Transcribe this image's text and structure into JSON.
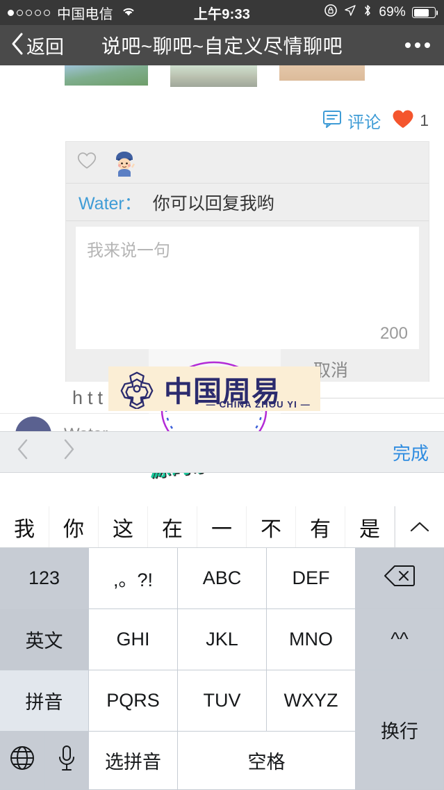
{
  "status_bar": {
    "signal_dots_total": 5,
    "signal_dots_filled": 1,
    "carrier": "中国电信",
    "wifi_icon": "wifi-icon",
    "time": "上午9:33",
    "rotation_lock_icon": "rotation-lock-icon",
    "location_icon": "location-arrow-icon",
    "bluetooth_icon": "bluetooth-icon",
    "battery_percent": "69%",
    "battery_level": 69
  },
  "nav_bar": {
    "back_icon": "chevron-left-icon",
    "back_label": "返回",
    "title": "说吧~聊吧~自定义尽情聊吧",
    "more_icon": "more-dots-icon"
  },
  "post": {
    "thumbnails": [
      "thumbnail-1",
      "thumbnail-2",
      "thumbnail-3"
    ],
    "comment_icon": "comment-bubble-icon",
    "comment_label": "评论",
    "like_icon": "heart-icon",
    "like_count": "1",
    "like_color": "#f4552d",
    "accent_color": "#3f9cd6"
  },
  "comment_card": {
    "like_outline_icon": "heart-outline-icon",
    "avatar_icon": "avatar-boy-icon",
    "author": "Water：",
    "message": "你可以回复我哟",
    "input_placeholder": "我来说一句",
    "input_value": "",
    "char_limit": "200",
    "cancel_label": "取消"
  },
  "second_comment": {
    "avatar_icon": "avatar-circle-icon",
    "author": "Water"
  },
  "watermarks": {
    "url_text": "http        .com",
    "logo_cn": "中国周易",
    "logo_en": "— CHINA ZHOU YI —",
    "logo_bg": "#fbeed5",
    "logo_fg": "#2b2b6e",
    "shop_text": "源码杂货小店",
    "shop_color": "#19c79b"
  },
  "keyboard_toolbar": {
    "prev_icon": "chevron-left-icon",
    "next_icon": "chevron-right-icon",
    "done_label": "完成",
    "done_color": "#2f8ce0"
  },
  "keyboard": {
    "candidates": [
      "我",
      "你",
      "这",
      "在",
      "一",
      "不",
      "有",
      "是"
    ],
    "expand_icon": "chevron-up-icon",
    "rows": [
      [
        {
          "label": "123",
          "name": "key-123",
          "style": "fn"
        },
        {
          "label": ",。?!",
          "name": "key-punctuation",
          "style": "white"
        },
        {
          "label": "ABC",
          "name": "key-abc",
          "style": "white"
        },
        {
          "label": "DEF",
          "name": "key-def",
          "style": "white"
        },
        {
          "label": "",
          "name": "key-delete",
          "style": "grayr",
          "icon": "delete-backspace-icon"
        }
      ],
      [
        {
          "label": "英文",
          "name": "key-english",
          "style": "fn2"
        },
        {
          "label": "GHI",
          "name": "key-ghi",
          "style": "white"
        },
        {
          "label": "JKL",
          "name": "key-jkl",
          "style": "white"
        },
        {
          "label": "MNO",
          "name": "key-mno",
          "style": "white"
        },
        {
          "label": "^^",
          "name": "key-emoticon",
          "style": "grayr"
        }
      ],
      [
        {
          "label": "拼音",
          "name": "key-pinyin",
          "style": "sel"
        },
        {
          "label": "PQRS",
          "name": "key-pqrs",
          "style": "white"
        },
        {
          "label": "TUV",
          "name": "key-tuv",
          "style": "white"
        },
        {
          "label": "WXYZ",
          "name": "key-wxyz",
          "style": "white"
        },
        {
          "label": "换行",
          "name": "key-return",
          "style": "grayr"
        }
      ],
      [
        {
          "label": "",
          "name": "key-globe",
          "style": "bottom",
          "icon": "globe-icon"
        },
        {
          "label": "",
          "name": "key-mic",
          "style": "bottom",
          "icon": "microphone-icon"
        },
        {
          "label": "选拼音",
          "name": "key-select-pinyin",
          "style": "white"
        },
        {
          "label": "空格",
          "name": "key-space",
          "style": "white"
        }
      ]
    ]
  }
}
